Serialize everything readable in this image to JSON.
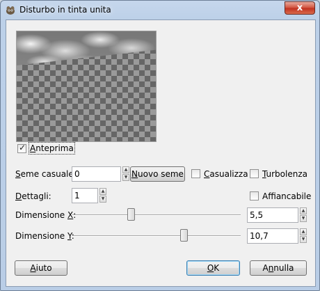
{
  "window": {
    "title": "Disturbo in tinta unita",
    "close_label": "x"
  },
  "preview": {
    "label_accel": "A",
    "label_rest": "nteprima",
    "checked": true
  },
  "seed": {
    "label_accel": "S",
    "label_rest": "eme casuale:",
    "value": "0",
    "new_seed_accel": "N",
    "new_seed_rest": "uovo seme"
  },
  "randomize": {
    "label_accel": "C",
    "label_rest": "asualizza",
    "checked": false
  },
  "turbulence": {
    "label_accel": "T",
    "label_rest": "urbolenza",
    "checked": false
  },
  "detail": {
    "label_accel": "D",
    "label_rest": "ettagli:",
    "value": "1"
  },
  "tileable": {
    "label_pre": "Aff",
    "label_accel": "i",
    "label_rest": "ancabile",
    "checked": false
  },
  "size_x": {
    "label_pre": "Dimensione ",
    "label_accel": "X",
    "label_rest": ":",
    "value": "5,5",
    "level": 0.34
  },
  "size_y": {
    "label_pre": "Dimensione ",
    "label_accel": "Y",
    "label_rest": ":",
    "value": "10,7",
    "level": 0.67
  },
  "buttons": {
    "help_accel": "A",
    "help_rest": "iuto",
    "ok_accel": "O",
    "ok_rest": "K",
    "cancel_pre": "A",
    "cancel_accel": "n",
    "cancel_rest": "nulla"
  }
}
